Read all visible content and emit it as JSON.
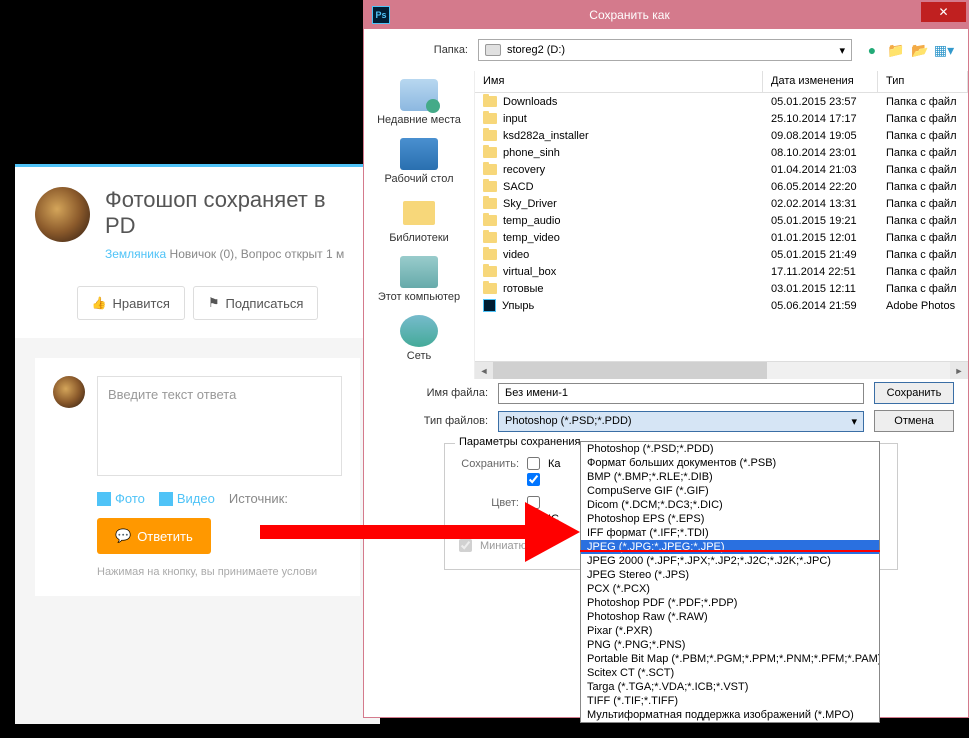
{
  "forum": {
    "title": "Фотошоп сохраняет в PD",
    "author": "Земляника",
    "meta_rest": " Новичок (0), Вопрос открыт 1 м",
    "like": "Нравится",
    "subscribe": "Подписаться",
    "placeholder": "Введите текст ответа",
    "photo": "Фото",
    "video": "Видео",
    "source": "Источник:",
    "submit": "Ответить",
    "note": "Нажимая на кнопку, вы принимаете услови"
  },
  "dialog": {
    "title": "Сохранить как",
    "folder_label": "Папка:",
    "folder_value": "storeg2 (D:)",
    "columns": {
      "name": "Имя",
      "date": "Дата изменения",
      "type": "Тип"
    },
    "sidebar": {
      "recent": "Недавние места",
      "desktop": "Рабочий стол",
      "libraries": "Библиотеки",
      "computer": "Этот компьютер",
      "network": "Сеть"
    },
    "files": [
      {
        "name": "Downloads",
        "date": "05.01.2015 23:57",
        "type": "Папка с файл",
        "kind": "folder"
      },
      {
        "name": "input",
        "date": "25.10.2014 17:17",
        "type": "Папка с файл",
        "kind": "folder"
      },
      {
        "name": "ksd282a_installer",
        "date": "09.08.2014 19:05",
        "type": "Папка с файл",
        "kind": "folder"
      },
      {
        "name": "phone_sinh",
        "date": "08.10.2014 23:01",
        "type": "Папка с файл",
        "kind": "folder"
      },
      {
        "name": "recovery",
        "date": "01.04.2014 21:03",
        "type": "Папка с файл",
        "kind": "folder"
      },
      {
        "name": "SACD",
        "date": "06.05.2014 22:20",
        "type": "Папка с файл",
        "kind": "folder"
      },
      {
        "name": "Sky_Driver",
        "date": "02.02.2014 13:31",
        "type": "Папка с файл",
        "kind": "folder"
      },
      {
        "name": "temp_audio",
        "date": "05.01.2015 19:21",
        "type": "Папка с файл",
        "kind": "folder"
      },
      {
        "name": "temp_video",
        "date": "01.01.2015 12:01",
        "type": "Папка с файл",
        "kind": "folder"
      },
      {
        "name": "video",
        "date": "05.01.2015 21:49",
        "type": "Папка с файл",
        "kind": "folder"
      },
      {
        "name": "virtual_box",
        "date": "17.11.2014 22:51",
        "type": "Папка с файл",
        "kind": "folder"
      },
      {
        "name": "готовые",
        "date": "03.01.2015 12:11",
        "type": "Папка с файл",
        "kind": "folder"
      },
      {
        "name": "Упырь",
        "date": "05.06.2014 21:59",
        "type": "Adobe Photos",
        "kind": "psd"
      }
    ],
    "filename_label": "Имя файла:",
    "filename_value": "Без имени-1",
    "type_label": "Тип файлов:",
    "type_value": "Photoshop (*.PSD;*.PDD)",
    "save_btn": "Сохранить",
    "cancel_btn": "Отмена",
    "params_legend": "Параметры сохранения",
    "save_label": "Сохранить:",
    "check_k": "Ка",
    "check_ic": "IC",
    "color_label": "Цвет:",
    "thumbnail": "Миниатюра"
  },
  "dropdown": {
    "items": [
      "Photoshop (*.PSD;*.PDD)",
      "Формат больших документов (*.PSB)",
      "BMP (*.BMP;*.RLE;*.DIB)",
      "CompuServe GIF (*.GIF)",
      "Dicom (*.DCM;*.DC3;*.DIC)",
      "Photoshop EPS (*.EPS)",
      "IFF формат (*.IFF;*.TDI)",
      "JPEG (*.JPG;*.JPEG;*.JPE)",
      "JPEG 2000 (*.JPF;*.JPX;*.JP2;*.J2C;*.J2K;*.JPC)",
      "JPEG Stereo (*.JPS)",
      "PCX (*.PCX)",
      "Photoshop PDF (*.PDF;*.PDP)",
      "Photoshop Raw (*.RAW)",
      "Pixar (*.PXR)",
      "PNG (*.PNG;*.PNS)",
      "Portable Bit Map (*.PBM;*.PGM;*.PPM;*.PNM;*.PFM;*.PAM)",
      "Scitex CT (*.SCT)",
      "Targa (*.TGA;*.VDA;*.ICB;*.VST)",
      "TIFF (*.TIF;*.TIFF)",
      "Мультиформатная поддержка изображений  (*.MPO)"
    ],
    "selected_index": 7
  }
}
